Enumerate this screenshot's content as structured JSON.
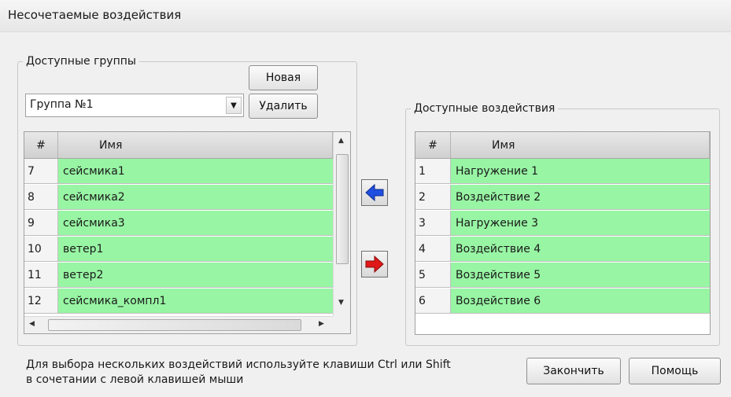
{
  "window": {
    "title": "Несочетаемые воздействия"
  },
  "groups": {
    "legend": "Доступные группы",
    "new_button": "Новая",
    "delete_button": "Удалить",
    "selected_group": "Группа №1",
    "table": {
      "col_num": "#",
      "col_name": "Имя",
      "rows": [
        {
          "num": "7",
          "name": "сейсмика1"
        },
        {
          "num": "8",
          "name": "сейсмика2"
        },
        {
          "num": "9",
          "name": "сейсмика3"
        },
        {
          "num": "10",
          "name": "ветер1"
        },
        {
          "num": "11",
          "name": "ветер2"
        },
        {
          "num": "12",
          "name": "сейсмика_компл1"
        }
      ]
    }
  },
  "actions": {
    "legend": "Доступные воздействия",
    "table": {
      "col_num": "#",
      "col_name": "Имя",
      "rows": [
        {
          "num": "1",
          "name": "Нагружение 1"
        },
        {
          "num": "2",
          "name": "Воздействие 2"
        },
        {
          "num": "3",
          "name": "Нагружение 3"
        },
        {
          "num": "4",
          "name": "Воздействие 4"
        },
        {
          "num": "5",
          "name": "Воздействие 5"
        },
        {
          "num": "6",
          "name": "Воздействие 6"
        }
      ]
    }
  },
  "transfer": {
    "left_icon": "arrow-left-icon",
    "right_icon": "arrow-right-icon",
    "left_color": "#1f4fe0",
    "right_color": "#e01818"
  },
  "hint": {
    "line1": "Для выбора нескольких воздействий используйте клавиши Ctrl или Shift",
    "line2": "в сочетании с левой клавишей мыши"
  },
  "footer": {
    "finish_button": "Закончить",
    "help_button": "Помощь"
  },
  "colors": {
    "row_fill": "#98f5a4"
  }
}
